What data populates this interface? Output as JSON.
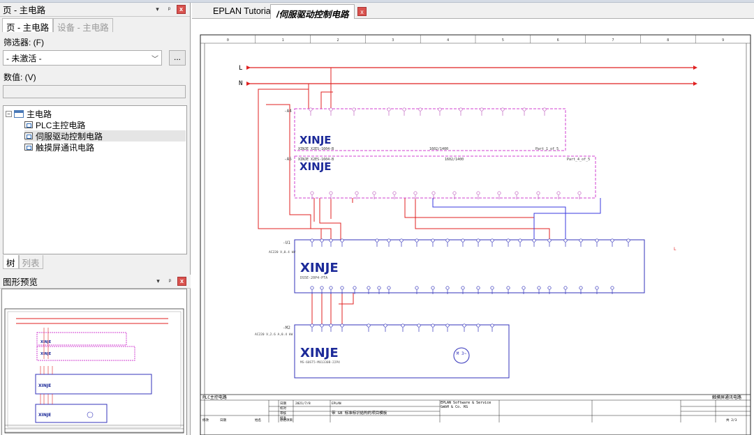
{
  "left_panel": {
    "title": "页 - 主电路",
    "tabs": [
      "页 - 主电路",
      "设备 - 主电路"
    ],
    "filter_label": "筛选器: (F)",
    "filter_value": "- 未激活 -",
    "filter_button": "...",
    "value_label": "数值: (V)",
    "value_text": "",
    "tree": {
      "root": "主电路",
      "items": [
        "PLC主控电路",
        "伺服驱动控制电路",
        "触摸屏通讯电路"
      ]
    },
    "bottom_tabs": [
      "树",
      "列表"
    ],
    "preview_title": "图形预览",
    "window_controls": {
      "dropdown": "▾",
      "pin": "ᵖ",
      "close": "x"
    }
  },
  "document_tabs": [
    "EPLAN Tutorials",
    "/伺服驱动控制电路"
  ],
  "schematic": {
    "line_labels": [
      "L",
      "N"
    ],
    "columns": [
      "0",
      "1",
      "2",
      "3",
      "4",
      "5",
      "6",
      "7",
      "8",
      "9"
    ],
    "devices": [
      {
        "tag": "-A4",
        "brand": "XINJE",
        "part": "XINJE  X2ES-1604-B",
        "extra1": "1602/1400",
        "extra2": "Part_1_of_5"
      },
      {
        "tag": "-A5",
        "brand": "XINJE",
        "part": "XINJE  X2ES-1604-B",
        "extra1": "1602/1400",
        "extra2": "Part_4_of_5"
      },
      {
        "tag": "-U1",
        "brand": "XINJE",
        "part": "DS5E-20P4-PTA",
        "note": "AC220 V,0.4 kW"
      },
      {
        "tag": "-M2",
        "brand": "XINJE",
        "part": "MS-60ST5-M01330B-22P4",
        "note": "AC220 V,2.6 A,0.4 kW"
      }
    ],
    "motor_symbol": "M 3~",
    "title_block": {
      "left_page": "PLC主控电路",
      "right_page": "触摸屏通讯电路",
      "date1": "2021/7/8",
      "company1": "EPLAN",
      "company2": "EPLAN Software & Service GmbH & Co. KG",
      "project": "带 GB 标准标识结构的项目模板",
      "rows": [
        "日期",
        "校对",
        "审核",
        "批准"
      ],
      "bottom_row": [
        "修改",
        "日期",
        "姓名",
        "原始项目"
      ],
      "sheet": "共 2/3"
    }
  },
  "colors": {
    "red_wire": "#e02020",
    "blue_wire": "#3a3adf",
    "dashed_box": "#d040d0",
    "device_box": "#3333bb"
  }
}
